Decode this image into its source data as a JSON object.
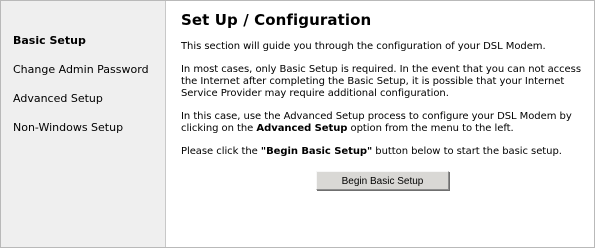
{
  "sidebar": {
    "items": [
      {
        "label": "Basic Setup",
        "active": true
      },
      {
        "label": "Change Admin Password",
        "active": false
      },
      {
        "label": "Advanced Setup",
        "active": false
      },
      {
        "label": "Non-Windows Setup",
        "active": false
      }
    ]
  },
  "main": {
    "title": "Set Up / Configuration",
    "p1": "This section will guide you through the configuration of your DSL Modem.",
    "p2": "In most cases, only Basic Setup is required. In the event that you can not access the Internet after completing the Basic Setup, it is possible that your Internet Service Provider may require additional configuration.",
    "p3_before": "In this case, use the Advanced Setup process to configure your DSL Modem by clicking on the ",
    "p3_bold": "Advanced Setup",
    "p3_after": " option from the menu to the left.",
    "p4_before": "Please click the ",
    "p4_bold": "\"Begin Basic Setup\"",
    "p4_after": " button below to start the basic setup.",
    "button_label": "Begin Basic Setup"
  }
}
